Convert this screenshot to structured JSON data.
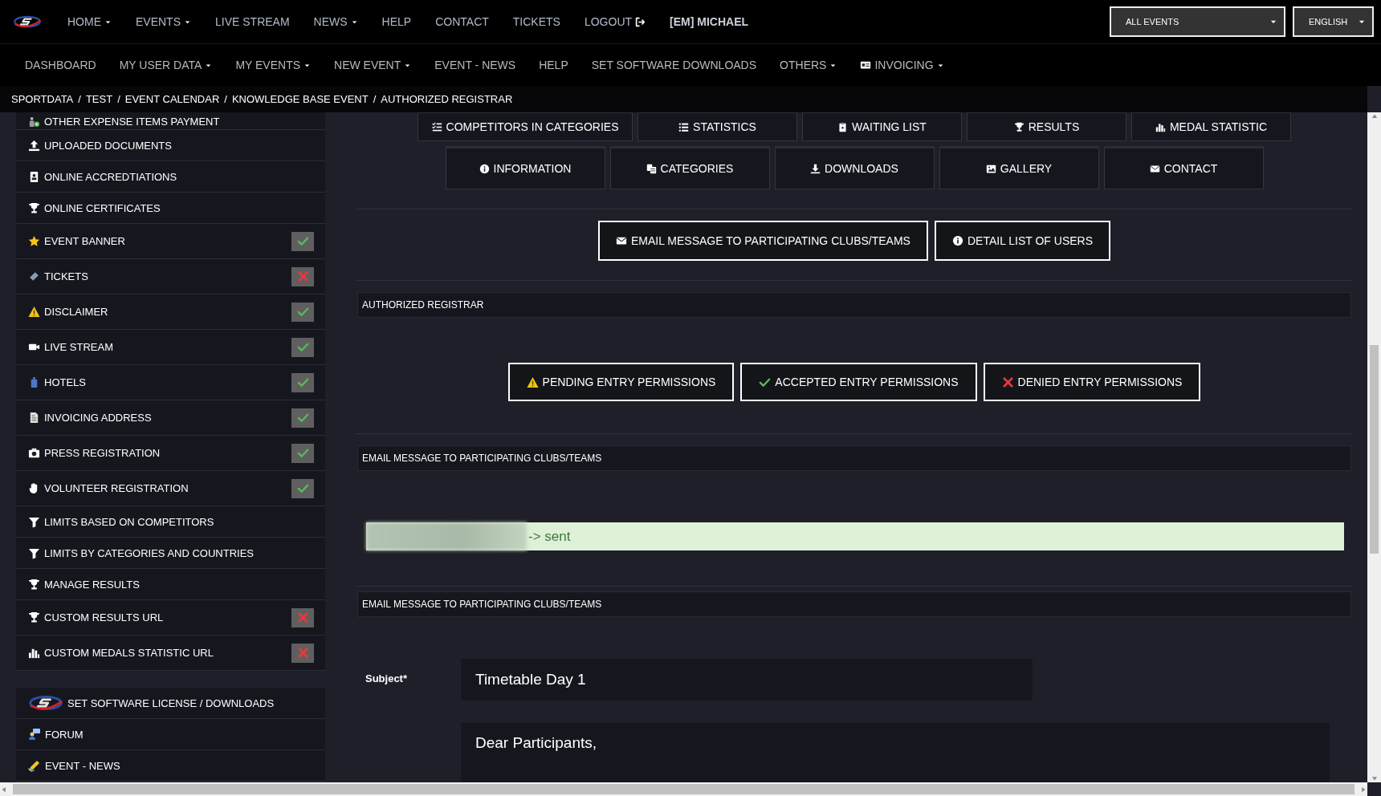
{
  "top_nav": {
    "items": [
      {
        "label": "HOME",
        "dropdown": true
      },
      {
        "label": "EVENTS",
        "dropdown": true
      },
      {
        "label": "LIVE STREAM",
        "dropdown": false
      },
      {
        "label": "NEWS",
        "dropdown": true
      },
      {
        "label": "HELP",
        "dropdown": false
      },
      {
        "label": "CONTACT",
        "dropdown": false
      },
      {
        "label": "TICKETS",
        "dropdown": false
      },
      {
        "label": "LOGOUT",
        "dropdown": false
      }
    ],
    "user": "[EM] MICHAEL"
  },
  "event_select": {
    "value": "ALL EVENTS"
  },
  "language_select": {
    "value": "ENGLISH"
  },
  "sub_nav": [
    {
      "label": "DASHBOARD",
      "dropdown": false
    },
    {
      "label": "MY USER DATA",
      "dropdown": true
    },
    {
      "label": "MY EVENTS",
      "dropdown": true
    },
    {
      "label": "NEW EVENT",
      "dropdown": true
    },
    {
      "label": "EVENT - NEWS",
      "dropdown": false
    },
    {
      "label": "HELP",
      "dropdown": false
    },
    {
      "label": "SET SOFTWARE DOWNLOADS",
      "dropdown": false
    },
    {
      "label": "OTHERS",
      "dropdown": true
    },
    {
      "label": "INVOICING",
      "dropdown": true
    }
  ],
  "breadcrumb": [
    {
      "label": "SPORTDATA",
      "separator": "/"
    },
    {
      "label": "TEST",
      "separator": "/"
    },
    {
      "label": "EVENT CALENDAR",
      "separator": "/"
    },
    {
      "label": "KNOWLEDGE BASE EVENT",
      "separator": "/"
    },
    {
      "label": "AUTHORIZED REGISTRAR"
    }
  ],
  "sidebar": {
    "items": [
      {
        "label": "OTHER EXPENSE ITEMS PAYMENT",
        "kind": "link"
      },
      {
        "label": "UPLOADED DOCUMENTS",
        "kind": "link"
      },
      {
        "label": "ONLINE ACCREDTIATIONS",
        "kind": "link"
      },
      {
        "label": "ONLINE CERTIFICATES",
        "kind": "link"
      },
      {
        "label": "EVENT BANNER",
        "kind": "status",
        "complete": true
      },
      {
        "label": "TICKETS",
        "kind": "status",
        "complete": false
      },
      {
        "label": "DISCLAIMER",
        "kind": "status",
        "complete": true
      },
      {
        "label": "LIVE STREAM",
        "kind": "status",
        "complete": true
      },
      {
        "label": "HOTELS",
        "kind": "status",
        "complete": true
      },
      {
        "label": "INVOICING ADDRESS",
        "kind": "status",
        "complete": true
      },
      {
        "label": "PRESS REGISTRATION",
        "kind": "status",
        "complete": true
      },
      {
        "label": "VOLUNTEER REGISTRATION",
        "kind": "status",
        "complete": true
      },
      {
        "label": "LIMITS BASED ON COMPETITORS",
        "kind": "link"
      },
      {
        "label": "LIMITS BY CATEGORIES AND COUNTRIES",
        "kind": "link"
      },
      {
        "label": "MANAGE RESULTS",
        "kind": "link"
      },
      {
        "label": "CUSTOM RESULTS URL",
        "kind": "status",
        "complete": false
      },
      {
        "label": "CUSTOM MEDALS STATISTIC URL",
        "kind": "status",
        "complete": false
      }
    ],
    "links": [
      "SET SOFTWARE LICENSE / DOWNLOADS",
      "FORUM",
      "EVENT - NEWS"
    ]
  },
  "event_menu": {
    "rows": [
      [
        "COMPETITORS IN CATEGORIES",
        "STATISTICS",
        "WAITING LIST",
        "RESULTS",
        "MEDAL STATISTIC"
      ],
      [
        "INFORMATION",
        "CATEGORIES",
        "DOWNLOADS",
        "GALLERY",
        "CONTACT"
      ]
    ]
  },
  "actions": [
    "EMAIL MESSAGE TO PARTICIPATING CLUBS/TEAMS",
    "DETAIL LIST OF USERS"
  ],
  "registrar_panel": {
    "title": "AUTHORIZED REGISTRAR",
    "buttons": [
      "PENDING ENTRY PERMISSIONS",
      "ACCEPTED ENTRY PERMISSIONS",
      "DENIED ENTRY PERMISSIONS"
    ]
  },
  "result_panel": {
    "title": "EMAIL MESSAGE TO PARTICIPATING CLUBS/TEAMS",
    "alert": "-> sent"
  },
  "email_panel": {
    "title": "EMAIL MESSAGE TO PARTICIPATING CLUBS/TEAMS",
    "subject_label": "Subject*",
    "subject": "Timetable Day 1",
    "message": "Dear Participants,"
  }
}
